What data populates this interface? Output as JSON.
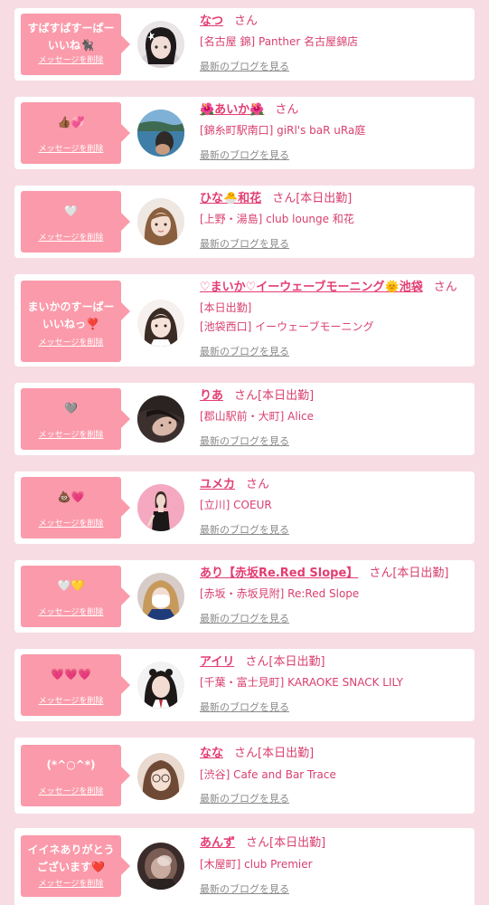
{
  "colors": {
    "page_background": "#f7dce4",
    "card_background": "#ffffff",
    "bubble": "#fb9aaa",
    "name": "#e33d72",
    "text": "#d9406f",
    "blog_link": "#8a8a8a"
  },
  "delete_label": "メッセージを削除",
  "blog_label": "最新のブログを見る",
  "items": [
    {
      "message": "すばすばすーぱー\nいいね🐈‍⬛",
      "name": "なつ",
      "honorific": "さん",
      "status": "",
      "status_line2": "",
      "shop": "[名古屋 錦] Panther 名古屋錦店"
    },
    {
      "message": "👍🏾💞",
      "name": "🌺あいか🌺",
      "honorific": "さん",
      "status": "",
      "status_line2": "",
      "shop": "[錦糸町駅南口] giRl's baR uRa庭"
    },
    {
      "message": "🤍",
      "name": "ひな🐣和花",
      "honorific": "さん",
      "status": "[本日出勤]",
      "status_line2": "",
      "shop": "[上野・湯島] club lounge 和花"
    },
    {
      "message": "まいかのすーぱー\nいいねっ❣️",
      "name": "♡まいか♡イーウェーブモーニング🌞池袋",
      "honorific": "さん",
      "status": "",
      "status_line2": "[本日出勤]",
      "shop": "[池袋西口] イーウェーブモーニング"
    },
    {
      "message": "🩶",
      "name": "りあ",
      "honorific": "さん",
      "status": "[本日出勤]",
      "status_line2": "",
      "shop": "[郡山駅前・大町] Alice"
    },
    {
      "message": "💩💗",
      "name": "ユメカ",
      "honorific": "さん",
      "status": "",
      "status_line2": "",
      "shop": "[立川] COEUR"
    },
    {
      "message": "🤍💛",
      "name": "あり【赤坂Re.Red Slope】",
      "honorific": "さん",
      "status": "[本日出勤]",
      "status_line2": "",
      "shop": "[赤坂・赤坂見附] Re:Red Slope"
    },
    {
      "message": "💗💗💗",
      "name": "アイリ",
      "honorific": "さん",
      "status": "[本日出勤]",
      "status_line2": "",
      "shop": "[千葉・富士見町] KARAOKE SNACK LILY"
    },
    {
      "message": "(*^○^*)",
      "name": "なな",
      "honorific": "さん",
      "status": "[本日出勤]",
      "status_line2": "",
      "shop": "[渋谷] Cafe and Bar Trace"
    },
    {
      "message": "イイネありがとう\nございます❤️",
      "name": "あんず",
      "honorific": "さん",
      "status": "[本日出勤]",
      "status_line2": "",
      "shop": "[木屋町] club Premier"
    }
  ]
}
